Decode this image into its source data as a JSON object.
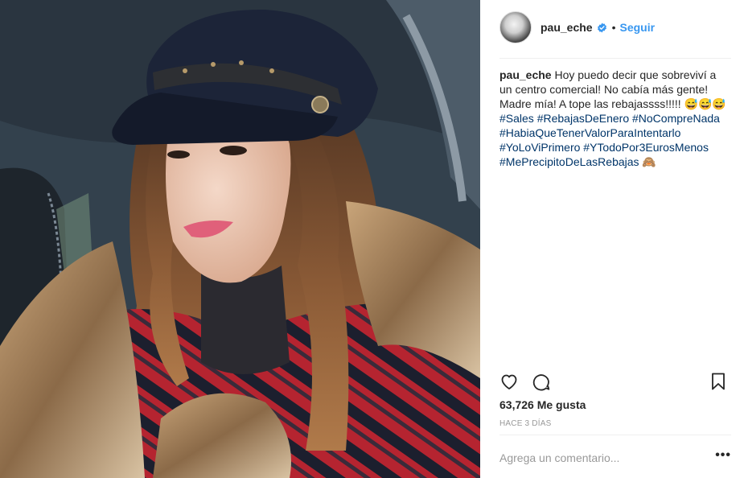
{
  "post": {
    "username": "pau_eche",
    "follow_label": "Seguir",
    "dot": "•",
    "caption": {
      "username": "pau_eche",
      "text": " Hoy puedo decir que sobreviví a un centro comercial! No cabía más gente! Madre mía! A tope las rebajassss!!!!! 😅😅😅",
      "hashtags": [
        "#Sales",
        "#RebajasDeEnero",
        "#NoCompreNada",
        "#HabiaQueTenerValorParaIntentarlo",
        "#YoLoViPrimero",
        "#YTodoPor3EurosMenos",
        "#MePrecipitoDeLasRebajas"
      ],
      "trailing_emoji": " 🙈"
    },
    "likes": "63,726 Me gusta",
    "time": "HACE 3 DÍAS",
    "comment_placeholder": "Agrega un comentario...",
    "more_label": "•••"
  },
  "colors": {
    "accent": "#3897f0",
    "hashtag": "#003569",
    "muted": "#999999",
    "text": "#262626"
  },
  "icons": {
    "verified": "verified-badge-icon",
    "like": "heart-icon",
    "comment": "comment-icon",
    "save": "bookmark-icon",
    "more": "more-options-icon"
  }
}
